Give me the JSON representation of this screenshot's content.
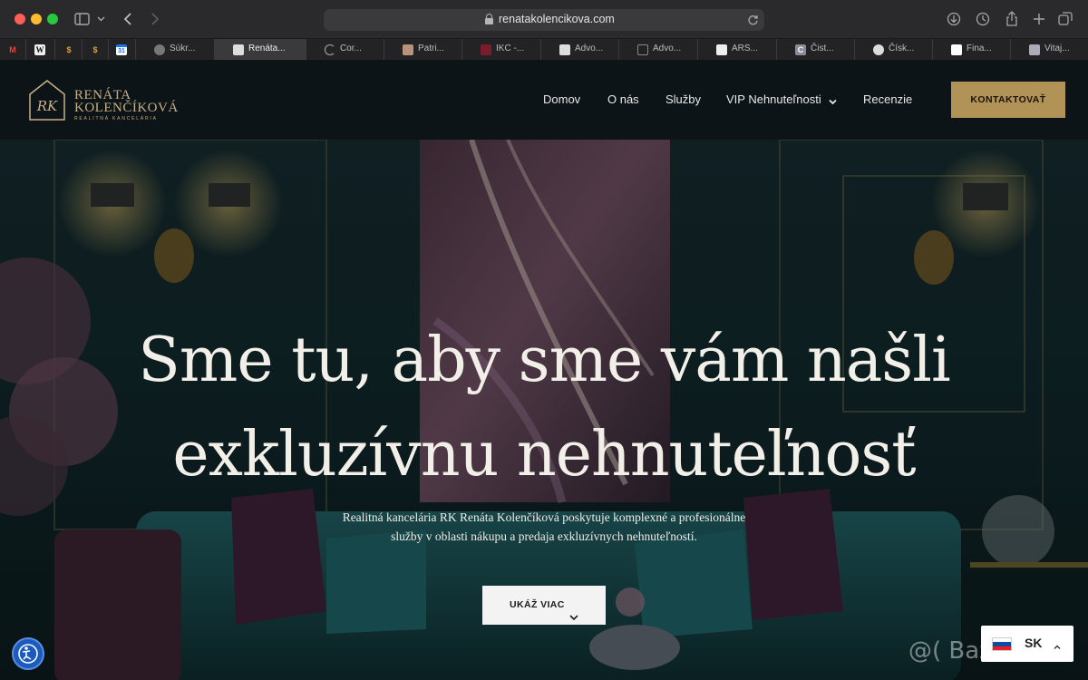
{
  "browser": {
    "url": "renatakolencikova.com",
    "tabs": [
      {
        "label": "",
        "icon": "gmail-icon"
      },
      {
        "label": "",
        "icon": "wikipedia-icon"
      },
      {
        "label": "",
        "icon": "dollar-icon"
      },
      {
        "label": "",
        "icon": "dollar-icon"
      },
      {
        "label": "",
        "icon": "calendar-icon"
      },
      {
        "label": "Súkr...",
        "icon": "globe-icon"
      },
      {
        "label": "Renáta...",
        "icon": "site-icon"
      },
      {
        "label": "Cor...",
        "icon": "loading-icon"
      },
      {
        "label": "Patri...",
        "icon": "site-icon"
      },
      {
        "label": "IKC -...",
        "icon": "site-icon"
      },
      {
        "label": "Advo...",
        "icon": "site-icon"
      },
      {
        "label": "Advo...",
        "icon": "site-icon"
      },
      {
        "label": "ARS...",
        "icon": "site-icon"
      },
      {
        "label": "Čist...",
        "icon": "letter-c-icon"
      },
      {
        "label": "Čísk...",
        "icon": "site-icon"
      },
      {
        "label": "Fina...",
        "icon": "site-icon"
      },
      {
        "label": "Vitaj...",
        "icon": "site-icon"
      }
    ]
  },
  "site": {
    "logo": {
      "monogram": "RK",
      "line1": "RENÁTA",
      "line2": "KOLENČÍKOVÁ",
      "tagline": "REALITNÁ KANCELÁRIA"
    },
    "nav": [
      {
        "label": "Domov"
      },
      {
        "label": "O nás"
      },
      {
        "label": "Služby"
      },
      {
        "label": "VIP Nehnuteľnosti"
      },
      {
        "label": "Recenzie"
      }
    ],
    "cta_label": "KONTAKTOVAŤ"
  },
  "hero": {
    "headline_line1": "Sme tu, aby sme vám našli",
    "headline_line2": "exkluzívnu nehnuteľnosť",
    "subtext_line1": "Realitná kancelária RK Renáta Kolenčíková poskytuje komplexné a profesionálne",
    "subtext_line2": "služby v oblasti nákupu a predaja exkluzívnych nehnuteľností.",
    "button_label": "UKÁŽ VIAC"
  },
  "language": {
    "code": "SK"
  },
  "watermark": "@( Bazos.sk",
  "colors": {
    "accent_gold": "#b19358",
    "header_bg": "#0c1417",
    "teal": "#0f2326"
  }
}
